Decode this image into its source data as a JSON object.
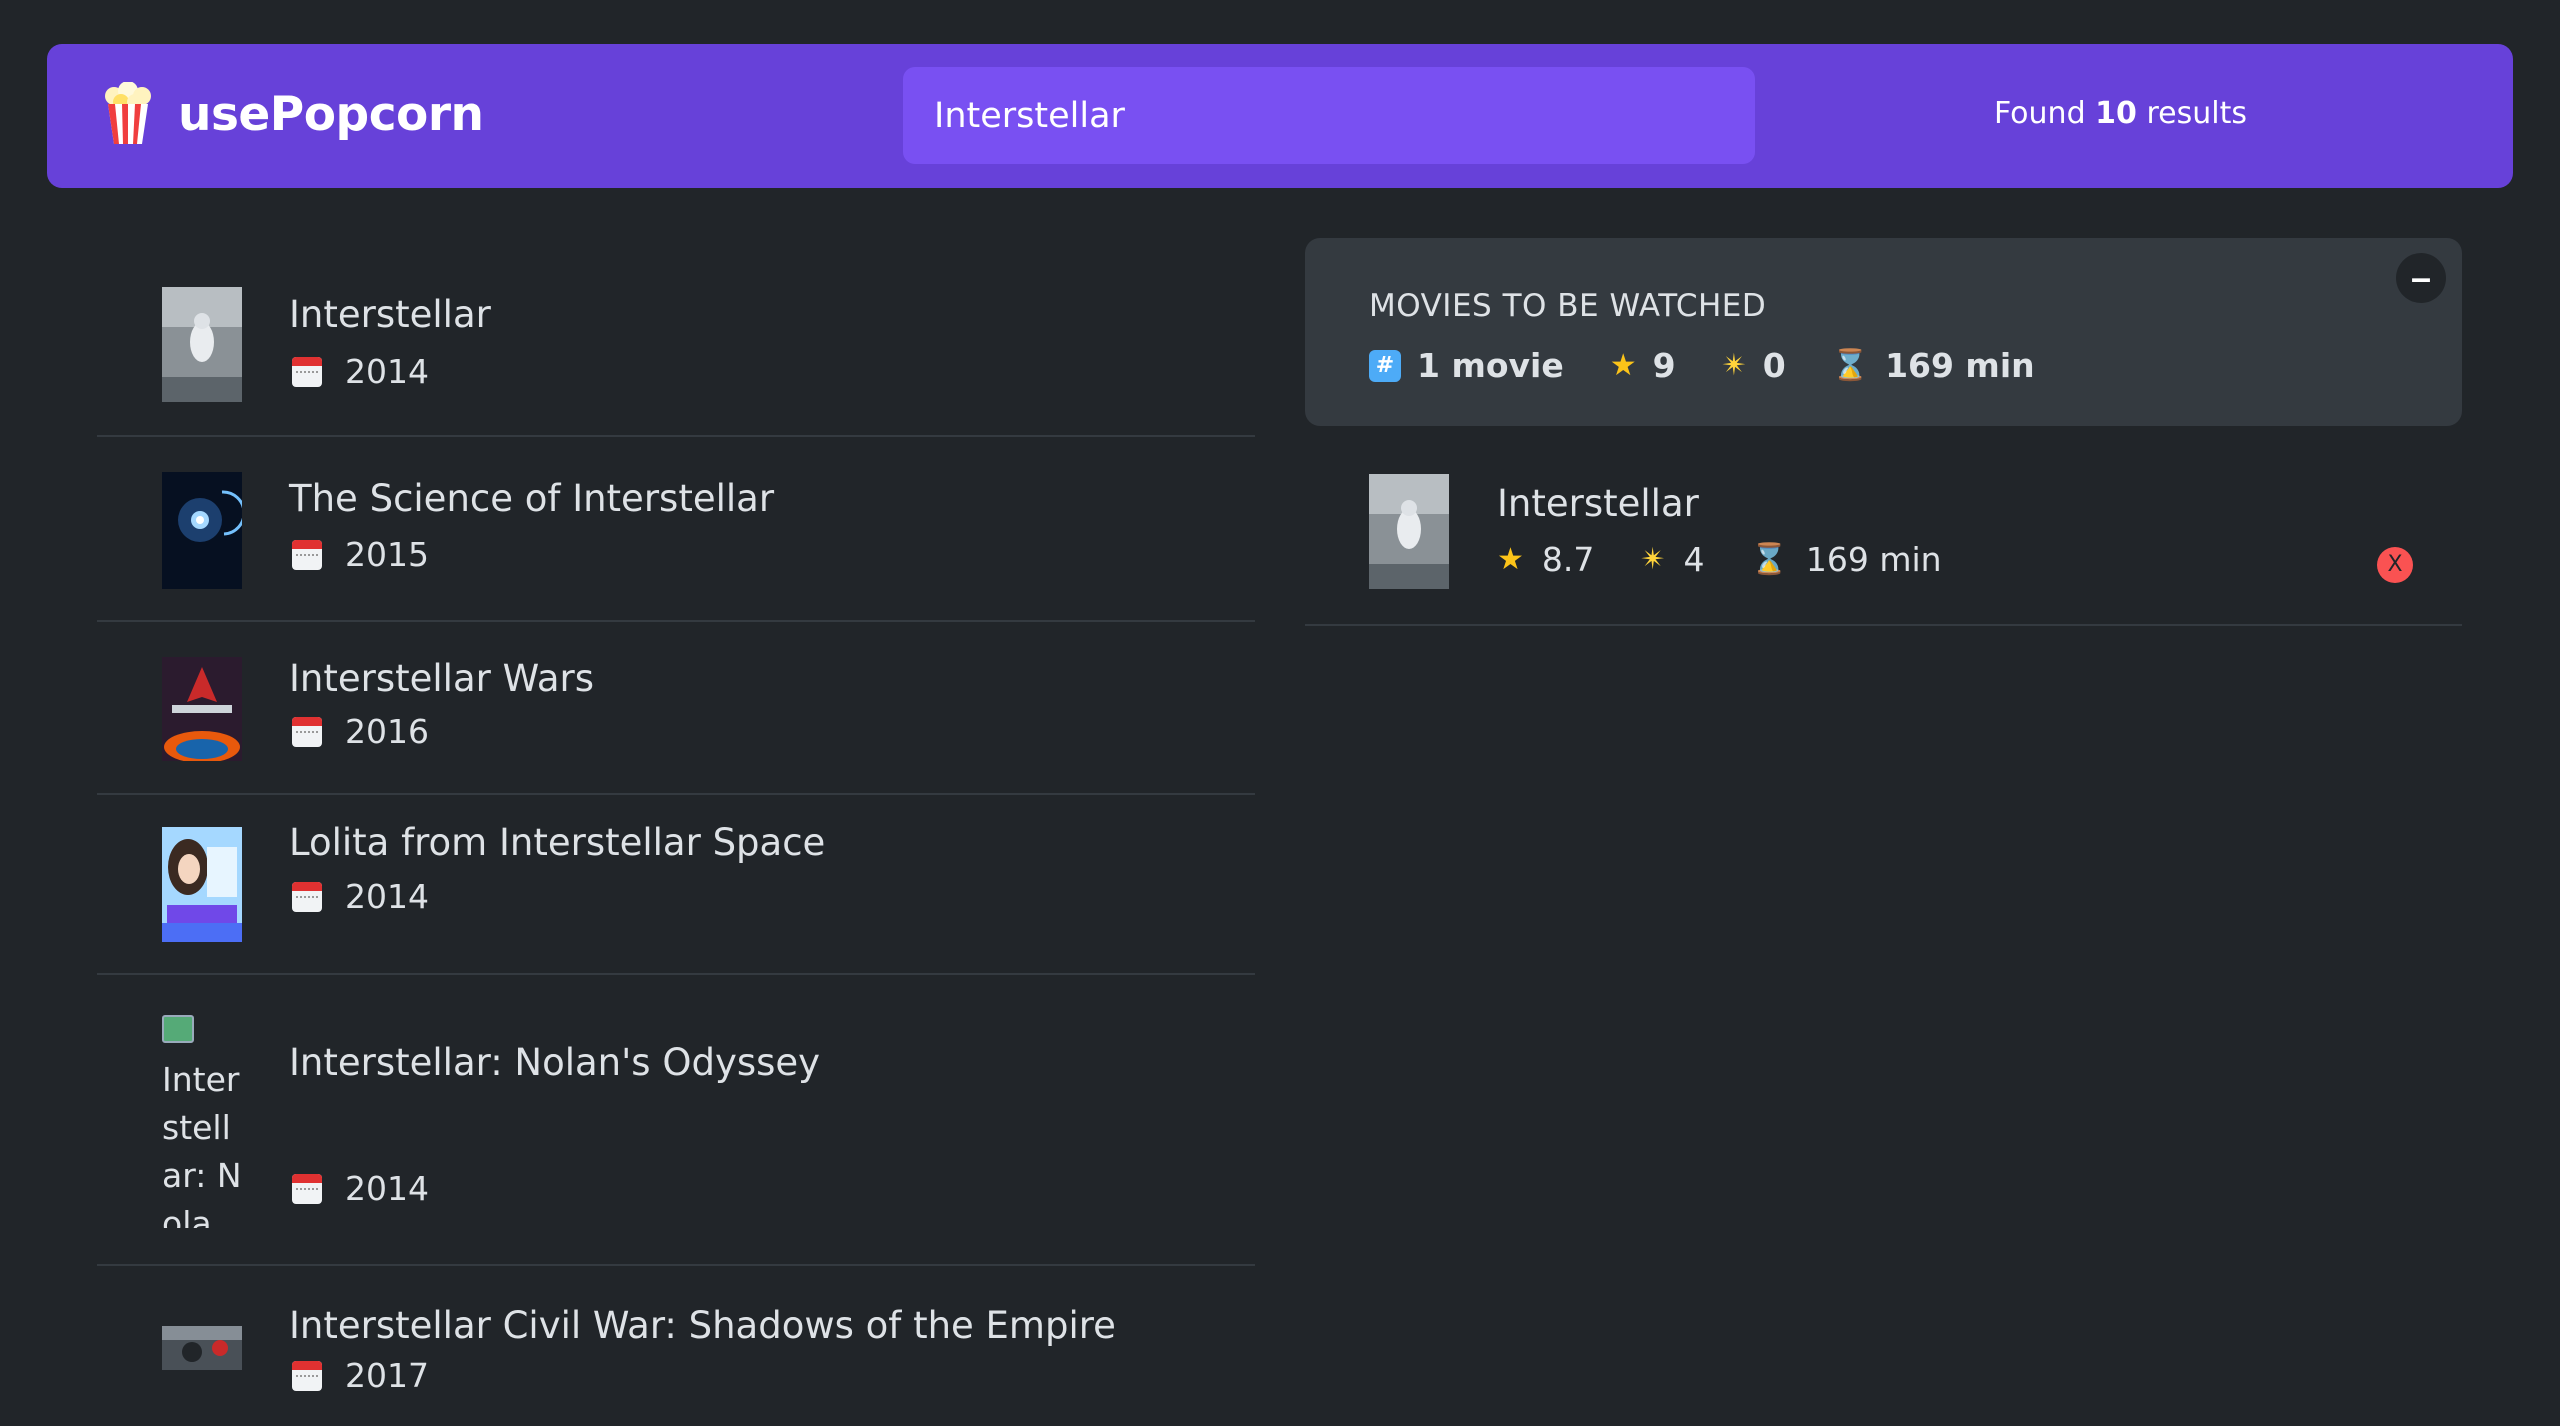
{
  "nav": {
    "logo_icon": "popcorn-icon",
    "logo_text": "usePopcorn",
    "search_value": "Interstellar",
    "results_prefix": "Found",
    "results_count": "10",
    "results_suffix": "results"
  },
  "movies": [
    {
      "title": "Interstellar",
      "year": "2014",
      "poster": "poster-interstellar"
    },
    {
      "title": "The Science of Interstellar",
      "year": "2015",
      "poster": "poster-science"
    },
    {
      "title": "Interstellar Wars",
      "year": "2016",
      "poster": "poster-wars"
    },
    {
      "title": "Lolita from Interstellar Space",
      "year": "2014",
      "poster": "poster-lolita"
    },
    {
      "title": "Interstellar: Nolan's Odyssey",
      "year": "2014",
      "poster_alt": "Interstellar: Nolan's Odyssey poster"
    },
    {
      "title": "Interstellar Civil War: Shadows of the Empire",
      "year": "2017",
      "poster": "poster-civil-war"
    }
  ],
  "summary": {
    "heading": "MOVIES TO BE WATCHED",
    "count": "1 movie",
    "imdb_avg": "9",
    "user_avg": "0",
    "runtime": "169 min",
    "toggle_label": "–"
  },
  "watched": [
    {
      "title": "Interstellar",
      "imdb": "8.7",
      "user": "4",
      "runtime": "169 min",
      "delete_label": "X"
    }
  ],
  "colors": {
    "background": "#212529",
    "nav": "#6741d9",
    "search": "#7950f2",
    "panel": "#343a40",
    "delete": "#fa5252"
  }
}
